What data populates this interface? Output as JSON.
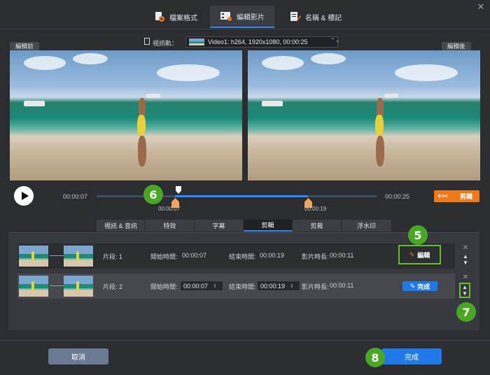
{
  "top_tabs": [
    {
      "label": "檔案格式",
      "icon": "file-format-icon"
    },
    {
      "label": "編輯影片",
      "icon": "video-edit-icon"
    },
    {
      "label": "名稱 & 標記",
      "icon": "rename-tag-icon"
    }
  ],
  "track": {
    "label": "視訊軌：",
    "value": "Video1: h264, 1920x1080, 00:00:25"
  },
  "labels": {
    "before": "編輯前",
    "after": "編輯後"
  },
  "player": {
    "time_start": "00:00:07",
    "time_end": "00:00:25",
    "sel_start": "00:00:07",
    "sel_end": "00:00:19",
    "cut_label": "剪輯",
    "duration_sec": 25,
    "playhead_sec": 7,
    "selection_start_sec": 7,
    "selection_end_sec": 19
  },
  "sub_tabs": [
    "視訊 & 音訊",
    "特效",
    "字幕",
    "剪輯",
    "剪裁",
    "浮水印"
  ],
  "sub_tabs_active": 3,
  "clips": [
    {
      "segment_label": "片段: 1",
      "start_label": "開始時間:",
      "start": "00:00:07",
      "end_label": "結束時間:",
      "end": "00:00:19",
      "duration_label": "影片時長:",
      "duration": "00:00:11",
      "action_label": "編輯"
    },
    {
      "segment_label": "片段: 2",
      "start_label": "開始時間:",
      "start": "00:00:07",
      "end_label": "結束時間:",
      "end": "00:00:19",
      "duration_label": "影片時長:",
      "duration": "00:00:11",
      "action_label": "完成"
    }
  ],
  "badges": [
    "5",
    "6",
    "7",
    "8"
  ],
  "footer": {
    "cancel": "取消",
    "finish": "完成"
  },
  "colors": {
    "accent": "#1f7ae8",
    "cut": "#f07a1a",
    "badge": "#4aa625",
    "highlight": "#5cc42a"
  }
}
